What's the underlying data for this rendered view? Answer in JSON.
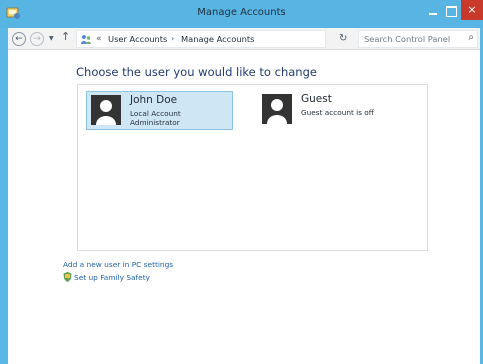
{
  "window": {
    "title": "Manage Accounts",
    "close_glyph": "×"
  },
  "nav": {
    "back_glyph": "←",
    "forward_glyph": "→",
    "recent_glyph": "▼",
    "up_glyph": "↑",
    "chevrons": "«",
    "breadcrumbs": [
      {
        "label": "User Accounts"
      },
      {
        "label": "Manage Accounts"
      }
    ],
    "separator": "›",
    "dropdown_glyph": "⌄",
    "refresh_glyph": "↻"
  },
  "search": {
    "placeholder": "Search Control Panel",
    "icon_glyph": "⌕"
  },
  "main": {
    "heading": "Choose the user you would like to change",
    "accounts": [
      {
        "name": "John Doe",
        "line1": "Local Account",
        "line2": "Administrator",
        "selected": true
      },
      {
        "name": "Guest",
        "line1": "Guest account is off",
        "line2": "",
        "selected": false
      }
    ],
    "links": [
      {
        "label": "Add a new user in PC settings"
      },
      {
        "label": "Set up Family Safety"
      }
    ]
  },
  "icons": {
    "app": "control-panel-icon",
    "address": "user-accounts-icon",
    "user": "user-avatar-icon",
    "family": "family-safety-icon"
  },
  "colors": {
    "titlebar": "#58b4e3",
    "close": "#c9392b",
    "heading": "#223b72",
    "link": "#1f63ab",
    "selected_tile": "#cfe7f5"
  }
}
